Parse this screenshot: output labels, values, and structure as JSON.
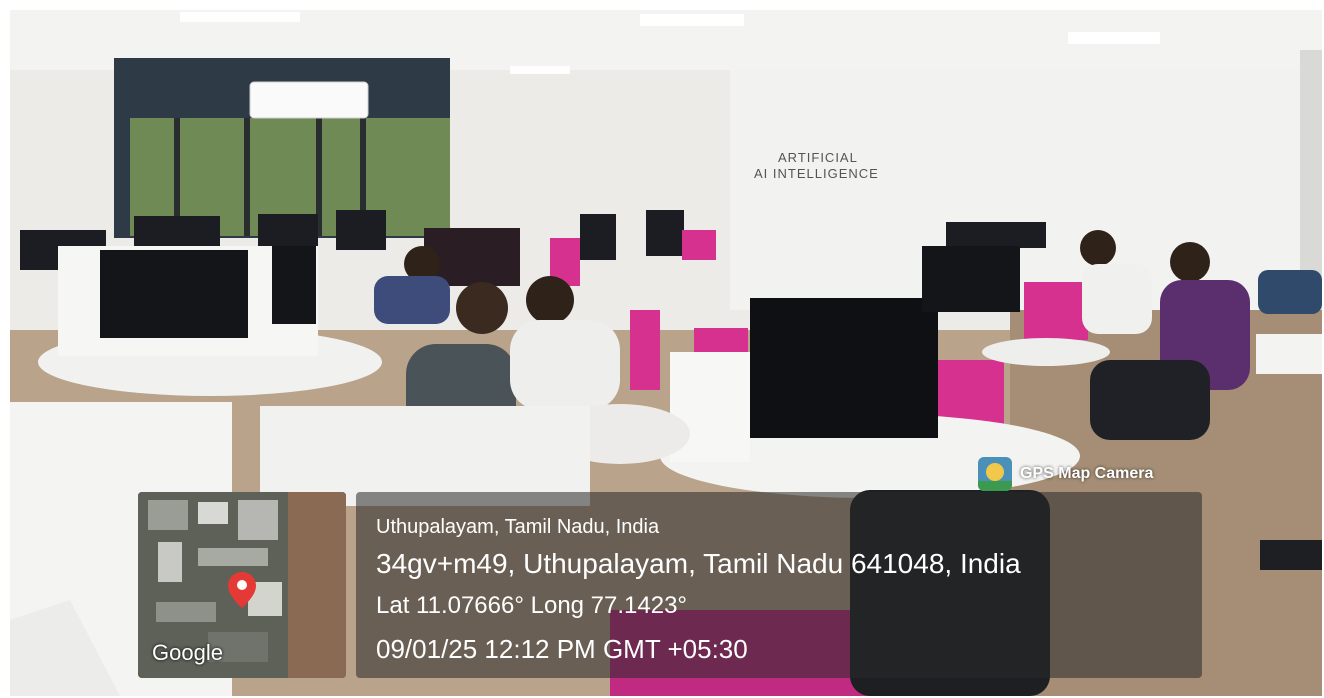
{
  "photo": {
    "wall_text": [
      "ARTIFICIAL",
      "AI INTELLIGENCE"
    ]
  },
  "badge": {
    "icon": "gps-map-camera-logo-icon",
    "label": "GPS Map Camera"
  },
  "map": {
    "provider": "Google",
    "pin_color": "#e53935"
  },
  "location": {
    "place": "Uthupalayam, Tamil Nadu, India",
    "address": "34gv+m49, Uthupalayam, Tamil Nadu 641048, India",
    "coordinates": "Lat 11.07666° Long 77.1423°",
    "datetime": "09/01/25 12:12 PM GMT +05:30"
  },
  "colors": {
    "accent_magenta": "#d6318f",
    "overlay_bg": "#282828"
  }
}
